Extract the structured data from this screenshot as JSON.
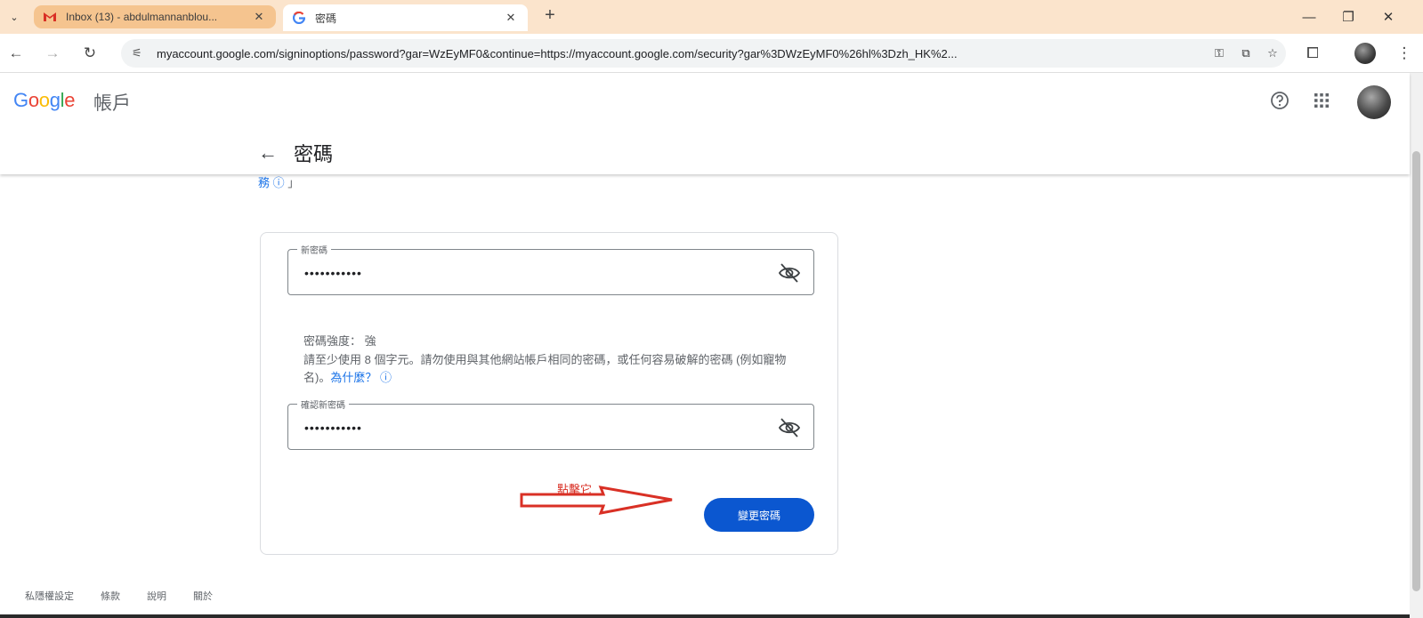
{
  "browser": {
    "tabs": [
      {
        "title": "Inbox (13) - abdulmannanblou...",
        "favicon": "gmail-icon",
        "active": false
      },
      {
        "title": "密碼",
        "favicon": "google-g-icon",
        "active": true
      }
    ],
    "url": "myaccount.google.com/signinoptions/password?gar=WzEyMF0&continue=https://myaccount.google.com/security?gar%3DWzEyMF0%26hl%3Dzh_HK%2..."
  },
  "header": {
    "logo_letters": [
      "G",
      "o",
      "o",
      "g",
      "l",
      "e"
    ],
    "logo_colors": [
      "#4285F4",
      "#EA4335",
      "#FBBC05",
      "#4285F4",
      "#34A853",
      "#EA4335"
    ],
    "product": "帳戶",
    "page_title": "密碼"
  },
  "intro": {
    "link_tail": "務"
  },
  "form": {
    "new_password_label": "新密碼",
    "new_password_value": "•••••••••••",
    "strength_text": "密碼強度： 強",
    "hint_text": "請至少使用 8 個字元。請勿使用與其他網站帳戶相同的密碼，或任何容易破解的密碼 (例如寵物名)。",
    "hint_link": "為什麼？",
    "confirm_label": "確認新密碼",
    "confirm_value": "•••••••••••",
    "submit_label": "變更密碼",
    "annotation": "點擊它"
  },
  "footer": {
    "links": [
      "私隱權設定",
      "條款",
      "說明",
      "關於"
    ]
  },
  "colors": {
    "accent": "#0b57d0",
    "link": "#1a73e8",
    "annotation": "#d93025",
    "tabstrip": "#fbe4cc"
  }
}
